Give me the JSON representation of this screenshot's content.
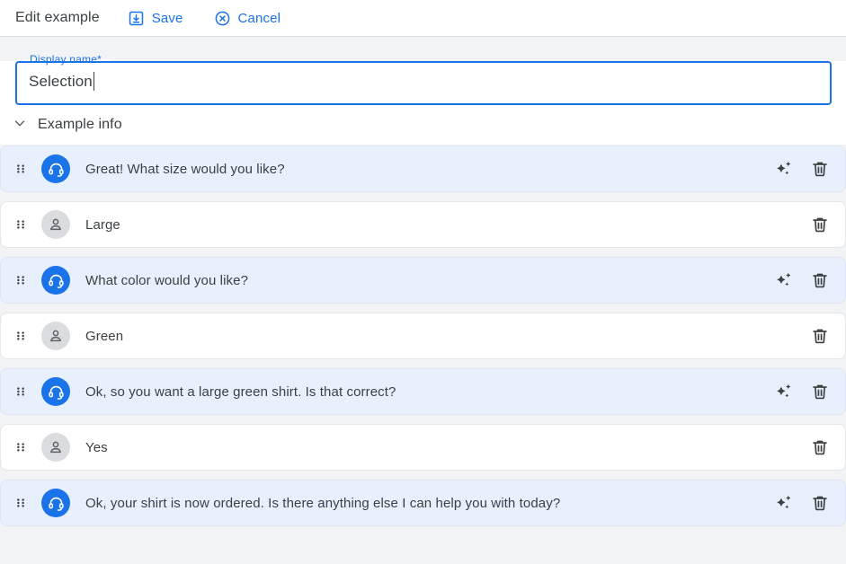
{
  "header": {
    "title": "Edit example",
    "save_label": "Save",
    "cancel_label": "Cancel",
    "save_icon": "save-icon",
    "cancel_icon": "cancel-circle-icon",
    "accent_color": "#1a73e8",
    "title_color": "#3c4043"
  },
  "form": {
    "display_name": {
      "label": "Display name*",
      "value": "Selection",
      "placeholder": "Display name",
      "focused": true,
      "border_color": "#1a73e8",
      "label_color": "#1a73e8"
    }
  },
  "section": {
    "title": "Example info",
    "expanded": true,
    "chevron_icon": "chevron-down-icon"
  },
  "rows": [
    {
      "speaker": "agent",
      "text": "Great! What size would you like?",
      "avatar_icon": "headset-icon",
      "avatar_color": "#1a73e8",
      "background": "#e8f0fe",
      "has_sparkle": true,
      "has_delete": true
    },
    {
      "speaker": "user",
      "text": "Large",
      "avatar_icon": "person-icon",
      "avatar_color": "#dadce0",
      "background": "#ffffff",
      "has_sparkle": false,
      "has_delete": true
    },
    {
      "speaker": "agent",
      "text": "What color would you like?",
      "avatar_icon": "headset-icon",
      "avatar_color": "#1a73e8",
      "background": "#e8f0fe",
      "has_sparkle": true,
      "has_delete": true
    },
    {
      "speaker": "user",
      "text": "Green",
      "avatar_icon": "person-icon",
      "avatar_color": "#dadce0",
      "background": "#ffffff",
      "has_sparkle": false,
      "has_delete": true
    },
    {
      "speaker": "agent",
      "text": "Ok, so you want a large green shirt. Is that correct?",
      "avatar_icon": "headset-icon",
      "avatar_color": "#1a73e8",
      "background": "#e8f0fe",
      "has_sparkle": true,
      "has_delete": true
    },
    {
      "speaker": "user",
      "text": "Yes",
      "avatar_icon": "person-icon",
      "avatar_color": "#dadce0",
      "background": "#ffffff",
      "has_sparkle": false,
      "has_delete": true
    },
    {
      "speaker": "agent",
      "text": "Ok, your shirt is now ordered. Is there anything else I can help you with today?",
      "avatar_icon": "headset-icon",
      "avatar_color": "#1a73e8",
      "background": "#e8f0fe",
      "has_sparkle": true,
      "has_delete": true
    }
  ],
  "icons": {
    "drag_handle": "drag-handle-icon",
    "sparkle": "sparkle-icon",
    "delete": "trash-icon"
  }
}
